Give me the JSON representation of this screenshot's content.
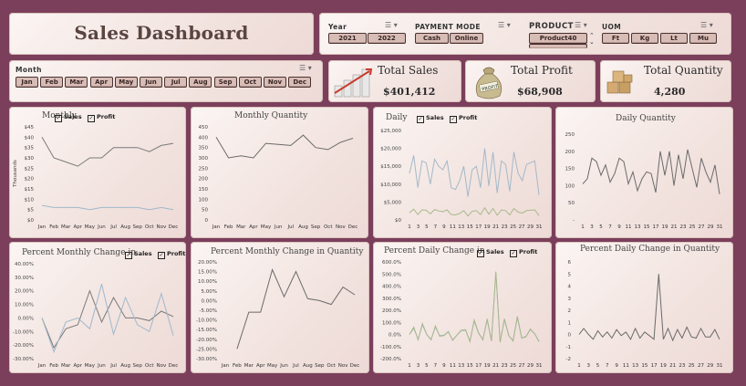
{
  "title": "Sales Dashboard",
  "slicers": {
    "year": {
      "title": "Year",
      "options": [
        "2021",
        "2022"
      ]
    },
    "payment_mode": {
      "title": "PAYMENT MODE",
      "options": [
        "Cash",
        "Online"
      ]
    },
    "product": {
      "title": "PRODUCT",
      "options": [
        "Product40"
      ]
    },
    "uom": {
      "title": "UOM",
      "options": [
        "Ft",
        "Kg",
        "Lt",
        "Mu"
      ]
    },
    "month": {
      "title": "Month",
      "options": [
        "Jan",
        "Feb",
        "Mar",
        "Apr",
        "May",
        "Jun",
        "Jul",
        "Aug",
        "Sep",
        "Oct",
        "Nov",
        "Dec"
      ]
    }
  },
  "kpis": {
    "sales": {
      "label": "Total Sales",
      "value": "$401,412"
    },
    "profit": {
      "label": "Total Profit",
      "value": "$68,908"
    },
    "quantity": {
      "label": "Total Quantity",
      "value": "4,280"
    }
  },
  "colors": {
    "frame": "#7b3f5b",
    "sales_line": "#7a7a7a",
    "profit_line": "#9fb8cc",
    "quantity_line": "#6a6a6a",
    "daily_profit": "#a9b98c",
    "daily_sales": "#a4b8c8"
  },
  "chart_data": [
    {
      "type": "line",
      "title": "Monthly",
      "ylabel": "Thousands",
      "legend": [
        "Sales",
        "Profit"
      ],
      "categories": [
        "Jan",
        "Feb",
        "Mar",
        "Apr",
        "May",
        "Jun",
        "Jul",
        "Aug",
        "Sep",
        "Oct",
        "Nov",
        "Dec"
      ],
      "yticks": [
        "$45",
        "$40",
        "$35",
        "$30",
        "$25",
        "$20",
        "$15",
        "$10",
        "$5",
        "$0"
      ],
      "ylim": [
        0,
        45
      ],
      "series": [
        {
          "name": "Sales",
          "values": [
            40,
            30,
            28,
            26,
            30,
            30,
            35,
            35,
            35,
            33,
            36,
            37
          ]
        },
        {
          "name": "Profit",
          "values": [
            7,
            6,
            6,
            6,
            5,
            6,
            6,
            6,
            6,
            5,
            6,
            5
          ]
        }
      ]
    },
    {
      "type": "line",
      "title": "Monthly Quantity",
      "categories": [
        "Jan",
        "Feb",
        "Mar",
        "Apr",
        "May",
        "Jun",
        "Jul",
        "Aug",
        "Sep",
        "Oct",
        "Nov",
        "Dec"
      ],
      "yticks": [
        "450",
        "400",
        "350",
        "300",
        "250",
        "200",
        "150",
        "100",
        "50",
        "0"
      ],
      "ylim": [
        0,
        450
      ],
      "series": [
        {
          "values": [
            400,
            300,
            310,
            300,
            370,
            365,
            360,
            410,
            350,
            340,
            375,
            395
          ]
        }
      ]
    },
    {
      "type": "line",
      "title": "Daily",
      "legend": [
        "Sales",
        "Profit"
      ],
      "categories": [
        "1",
        "3",
        "5",
        "7",
        "9",
        "11",
        "13",
        "15",
        "17",
        "19",
        "21",
        "23",
        "25",
        "27",
        "29",
        "31"
      ],
      "yticks": [
        "$25,000",
        "$20,000",
        "$15,000",
        "$10,000",
        "$5,000",
        "$0"
      ],
      "ylim": [
        0,
        25000
      ],
      "series": [
        {
          "name": "Sales",
          "values": [
            13000,
            18000,
            9000,
            16500,
            16000,
            10000,
            17000,
            15000,
            14000,
            16500,
            9000,
            8500,
            11000,
            15000,
            6500,
            14000,
            15000,
            9000,
            20000,
            9500,
            19000,
            7500,
            16500,
            15500,
            8000,
            19000,
            13000,
            11000,
            15500,
            16000,
            16500,
            7000
          ]
        },
        {
          "name": "Profit",
          "values": [
            2000,
            3000,
            1500,
            2800,
            2700,
            1700,
            2900,
            2500,
            2300,
            2800,
            1500,
            1400,
            1800,
            2600,
            1100,
            2400,
            2600,
            1500,
            3400,
            1600,
            3200,
            1300,
            2800,
            2600,
            1400,
            3200,
            2200,
            1900,
            2600,
            2700,
            2800,
            1200
          ]
        }
      ]
    },
    {
      "type": "line",
      "title": "Daily Quantity",
      "categories": [
        "1",
        "3",
        "5",
        "7",
        "9",
        "11",
        "13",
        "15",
        "17",
        "19",
        "21",
        "23",
        "25",
        "27",
        "29",
        "31"
      ],
      "yticks": [
        "250",
        "200",
        "150",
        "100",
        "50",
        "-"
      ],
      "ylim": [
        0,
        250
      ],
      "series": [
        {
          "values": [
            105,
            120,
            180,
            170,
            130,
            160,
            110,
            135,
            180,
            170,
            105,
            140,
            85,
            120,
            140,
            135,
            80,
            200,
            130,
            200,
            100,
            190,
            120,
            205,
            150,
            95,
            180,
            140,
            110,
            160,
            75
          ]
        }
      ]
    },
    {
      "type": "line",
      "title": "Percent Monthly Change in",
      "legend": [
        "Sales",
        "Profit"
      ],
      "categories": [
        "Jan",
        "Feb",
        "Mar",
        "Apr",
        "May",
        "Jun",
        "Jul",
        "Aug",
        "Sep",
        "Oct",
        "Nov",
        "Dec"
      ],
      "yticks": [
        "40.00%",
        "30.00%",
        "20.00%",
        "10.00%",
        "0.00%",
        "-10.00%",
        "-20.00%",
        "-30.00%"
      ],
      "ylim": [
        -30,
        40
      ],
      "series": [
        {
          "name": "Sales",
          "values": [
            0,
            -22,
            -8,
            -5,
            20,
            -3,
            15,
            0,
            0,
            -2,
            5,
            1
          ]
        },
        {
          "name": "Profit",
          "values": [
            0,
            -25,
            -3,
            0,
            -8,
            25,
            -12,
            15,
            -5,
            -10,
            18,
            -13
          ]
        }
      ]
    },
    {
      "type": "line",
      "title": "Percent Monthly Change in Quantity",
      "categories": [
        "Jan",
        "Feb",
        "Mar",
        "Apr",
        "May",
        "Jun",
        "Jul",
        "Aug",
        "Sep",
        "Oct",
        "Nov",
        "Dec"
      ],
      "yticks": [
        "20.00%",
        "15.00%",
        "10.00%",
        "5.00%",
        "0.00%",
        "-5.00%",
        "-10.00%",
        "-15.00%",
        "-20.00%",
        "-25.00%",
        "-30.00%"
      ],
      "ylim": [
        -30,
        20
      ],
      "series": [
        {
          "values": [
            null,
            -25,
            -6,
            -6,
            16,
            2,
            15,
            1,
            0,
            -2,
            7,
            3
          ]
        }
      ]
    },
    {
      "type": "line",
      "title": "Percent Daily Change in",
      "legend": [
        "Sales",
        "Profit"
      ],
      "categories": [
        "1",
        "3",
        "5",
        "7",
        "9",
        "11",
        "13",
        "15",
        "17",
        "19",
        "21",
        "23",
        "25",
        "27",
        "29",
        "31"
      ],
      "yticks": [
        "600.0%",
        "500.0%",
        "400.0%",
        "300.0%",
        "200.0%",
        "100.0%",
        "0.0%",
        "-100.0%",
        "-200.0%"
      ],
      "ylim": [
        -200,
        600
      ],
      "series": [
        {
          "name": "Sales",
          "values": [
            0,
            50,
            -40,
            80,
            0,
            -40,
            60,
            -10,
            -5,
            20,
            -45,
            -5,
            30,
            35,
            -55,
            110,
            10,
            -40,
            120,
            -50,
            510,
            -60,
            120,
            -10,
            -50,
            140,
            -30,
            -15,
            40,
            5,
            -55
          ]
        },
        {
          "name": "Profit",
          "values": [
            0,
            60,
            -45,
            90,
            0,
            -45,
            70,
            -15,
            -10,
            25,
            -50,
            -5,
            35,
            40,
            -60,
            120,
            15,
            -45,
            130,
            -55,
            520,
            -65,
            130,
            -10,
            -55,
            150,
            -30,
            -20,
            45,
            5,
            -60
          ]
        }
      ]
    },
    {
      "type": "line",
      "title": "Percent Daily Change in Quantity",
      "categories": [
        "1",
        "3",
        "5",
        "7",
        "9",
        "11",
        "13",
        "15",
        "17",
        "19",
        "21",
        "23",
        "25",
        "27",
        "29",
        "31"
      ],
      "yticks": [
        "6",
        "5",
        "4",
        "3",
        "2",
        "1",
        "0",
        "-1",
        "-2"
      ],
      "ylim": [
        -2,
        6
      ],
      "series": [
        {
          "values": [
            0,
            0.5,
            0,
            -0.4,
            0.3,
            -0.2,
            0.2,
            -0.3,
            0.4,
            -0.1,
            0.2,
            -0.4,
            0.5,
            -0.3,
            0.2,
            -0.1,
            -0.4,
            5,
            -0.4,
            0.5,
            -0.5,
            0.4,
            -0.3,
            0.6,
            -0.2,
            -0.3,
            0.5,
            -0.2,
            -0.2,
            0.4,
            -0.4
          ]
        }
      ]
    }
  ]
}
